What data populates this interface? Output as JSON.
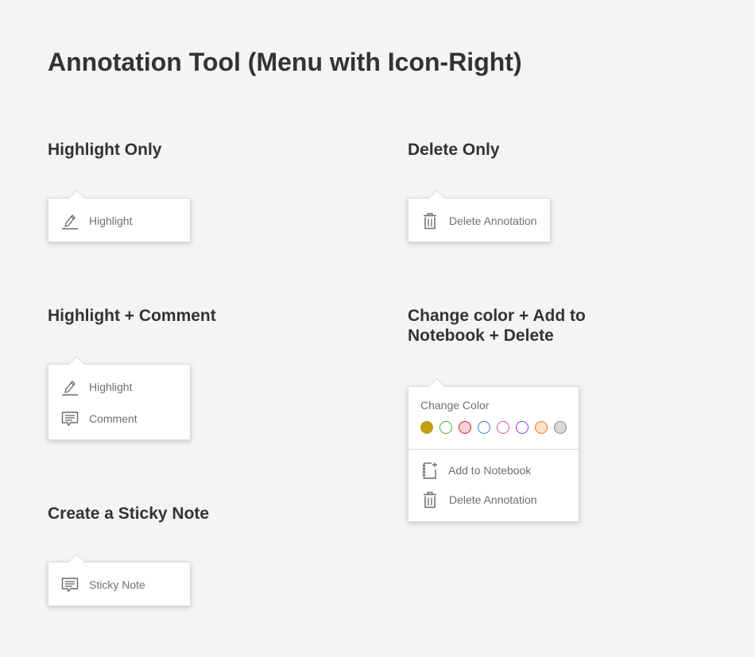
{
  "page_title": "Annotation Tool (Menu with Icon-Right)",
  "sections": {
    "highlight_only": {
      "title": "Highlight Only",
      "items": [
        {
          "icon": "pencil-highlight-icon",
          "label": "Highlight"
        }
      ]
    },
    "delete_only": {
      "title": "Delete Only",
      "items": [
        {
          "icon": "trash-icon",
          "label": "Delete Annotation"
        }
      ]
    },
    "highlight_comment": {
      "title": "Highlight + Comment",
      "items": [
        {
          "icon": "pencil-highlight-icon",
          "label": "Highlight"
        },
        {
          "icon": "comment-icon",
          "label": "Comment"
        }
      ]
    },
    "color_notebook_delete": {
      "title_line1": "Change color + Add to",
      "title_line2": "Notebook + Delete",
      "change_color_label": "Change Color",
      "swatches": [
        {
          "name": "yellow",
          "fill": "#c0a016",
          "border": "#c0a016"
        },
        {
          "name": "green",
          "fill": "#ffffff",
          "border": "#4caf2a"
        },
        {
          "name": "red",
          "fill": "#f6d3d6",
          "border": "#d0202e"
        },
        {
          "name": "blue",
          "fill": "#ffffff",
          "border": "#3a78d8"
        },
        {
          "name": "pink",
          "fill": "#ffffff",
          "border": "#e04ea0"
        },
        {
          "name": "purple",
          "fill": "#ffffff",
          "border": "#9c3cc0"
        },
        {
          "name": "orange",
          "fill": "#fde0c8",
          "border": "#e77a1e"
        },
        {
          "name": "gray",
          "fill": "#d8d8d8",
          "border": "#8a8a8a"
        }
      ],
      "items": [
        {
          "icon": "notebook-add-icon",
          "label": "Add to Notebook"
        },
        {
          "icon": "trash-icon",
          "label": "Delete Annotation"
        }
      ]
    },
    "sticky_note": {
      "title": "Create a Sticky Note",
      "items": [
        {
          "icon": "sticky-note-icon",
          "label": "Sticky Note"
        }
      ]
    }
  },
  "colors": {
    "background": "#f4f4f4",
    "heading": "#333333",
    "menu_text": "#6f6f6f",
    "icon": "#6a6a6a"
  }
}
